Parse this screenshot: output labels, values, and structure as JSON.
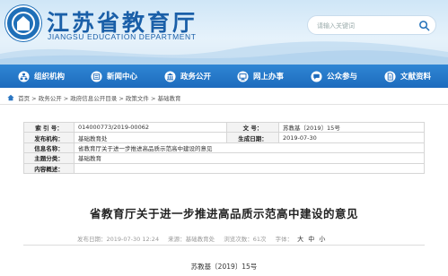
{
  "header": {
    "site_title": "江苏省教育厅",
    "site_subtitle": "JIANGSU EDUCATION DEPARTMENT",
    "search_placeholder": "请输入关键词"
  },
  "nav": {
    "items": [
      {
        "label": "组织机构",
        "icon": "org-chart-icon"
      },
      {
        "label": "新闻中心",
        "icon": "news-icon"
      },
      {
        "label": "政务公开",
        "icon": "gov-affairs-icon"
      },
      {
        "label": "网上办事",
        "icon": "online-service-icon"
      },
      {
        "label": "公众参与",
        "icon": "public-participation-icon"
      },
      {
        "label": "文献资料",
        "icon": "documents-icon"
      }
    ]
  },
  "breadcrumb": {
    "items": [
      "首页",
      "政务公开",
      "政府信息公开目录",
      "政策文件",
      "基础教育"
    ],
    "separator": ">"
  },
  "info_table": {
    "index_label": "索 引 号：",
    "index_value": "014000773/2019-00062",
    "doc_no_label": "文 号：",
    "doc_no_value": "苏教基〔2019〕15号",
    "publisher_label": "发布机构：",
    "publisher_value": "基础教育处",
    "date_label": "生成日期：",
    "date_value": "2019-07-30",
    "name_label": "信息名称：",
    "name_value": "省教育厅关于进一步推进高品质示范高中建设的意见",
    "subject_label": "主题分类：",
    "subject_value": "基础教育",
    "summary_label": "内容概述：",
    "summary_value": ""
  },
  "article": {
    "title": "省教育厅关于进一步推进高品质示范高中建设的意见",
    "publish_time": "发布日期：2019-07-30 12:24",
    "source": "来源：基础教育处",
    "views": "浏览次数：61次",
    "font_size_label": "字体：",
    "font_size_options": [
      "大",
      "中",
      "小"
    ],
    "doc_number": "苏教基〔2019〕15号"
  },
  "colors": {
    "brand_blue": "#1a5fa8",
    "nav_blue": "#1d6bbd"
  }
}
